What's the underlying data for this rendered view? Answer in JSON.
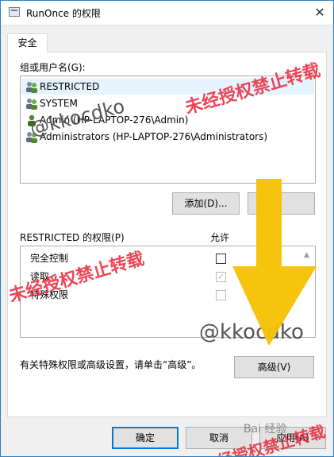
{
  "window": {
    "title": "RunOnce 的权限",
    "close_glyph": "✕"
  },
  "tabs": [
    {
      "label": "安全"
    }
  ],
  "group_label": "组或用户名(G):",
  "users": [
    {
      "name": "RESTRICTED",
      "icon": "user-group-icon",
      "selected": true
    },
    {
      "name": "SYSTEM",
      "icon": "user-group-icon",
      "selected": false
    },
    {
      "name": "Admin (HP-LAPTOP-276\\Admin)",
      "icon": "user-icon",
      "selected": false
    },
    {
      "name": "Administrators (HP-LAPTOP-276\\Administrators)",
      "icon": "user-group-icon",
      "selected": false
    }
  ],
  "buttons": {
    "add": "添加(D)...",
    "advanced": "高级(V)",
    "ok": "确定",
    "cancel": "取消",
    "apply": "应用(A)"
  },
  "permissions_label": "RESTRICTED 的权限(P)",
  "allow_header": "允许",
  "permissions": [
    {
      "name": "完全控制",
      "allowed": false,
      "enabled": true
    },
    {
      "name": "读取",
      "allowed": true,
      "enabled": false
    },
    {
      "name": "特殊权限",
      "allowed": false,
      "enabled": false
    }
  ],
  "check_glyph": "✓",
  "advanced_hint": "有关特殊权限或高级设置，请单击“高级”。",
  "watermarks": {
    "top": "未经授权禁止转载",
    "mid": "未经授权禁止转载",
    "bottom": "未经授权禁止转载",
    "handle1": "@kkocdko",
    "handle2": "@kkocdko",
    "baidu": "Bai 经验"
  },
  "colors": {
    "accent": "#0078d7",
    "watermark": "#e8283a",
    "arrow": "#f5c000"
  }
}
